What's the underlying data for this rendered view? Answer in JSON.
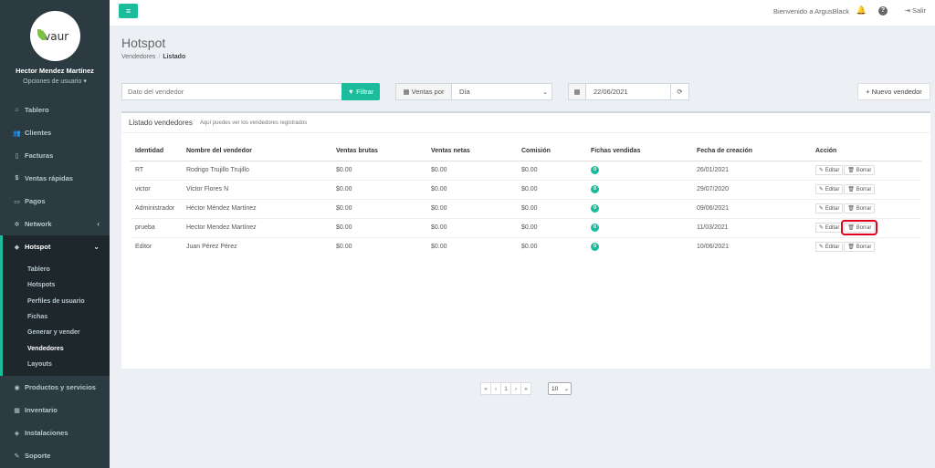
{
  "sidebar": {
    "logo_text": "ivaur",
    "user_name": "Hector Mendez Martínez",
    "user_options": "Opciones de usuario",
    "items": [
      {
        "label": "Tablero",
        "icon": "dashboard-icon",
        "glyph": "⌂"
      },
      {
        "label": "Clientes",
        "icon": "users-icon",
        "glyph": "👥"
      },
      {
        "label": "Facturas",
        "icon": "document-icon",
        "glyph": "▯"
      },
      {
        "label": "Ventas rápidas",
        "icon": "dollar-icon",
        "glyph": "$"
      },
      {
        "label": "Pagos",
        "icon": "money-icon",
        "glyph": "▭"
      },
      {
        "label": "Network",
        "icon": "network-icon",
        "glyph": "✲",
        "caret": "‹"
      },
      {
        "label": "Hotspot",
        "icon": "wifi-icon",
        "glyph": "◆",
        "caret": "⌄"
      }
    ],
    "hotspot_sub": [
      {
        "label": "Tablero"
      },
      {
        "label": "Hotspots"
      },
      {
        "label": "Perfiles de usuario"
      },
      {
        "label": "Fichas"
      },
      {
        "label": "Generar y vender"
      },
      {
        "label": "Vendedores"
      },
      {
        "label": "Layouts"
      }
    ],
    "bottom_items": [
      {
        "label": "Productos y servicios",
        "icon": "tags-icon",
        "glyph": "◉"
      },
      {
        "label": "Inventario",
        "icon": "cubes-icon",
        "glyph": "▦"
      },
      {
        "label": "Instalaciones",
        "icon": "tag-icon",
        "glyph": "◈"
      },
      {
        "label": "Soporte",
        "icon": "wrench-icon",
        "glyph": "✎"
      }
    ]
  },
  "topbar": {
    "menu_icon": "≡",
    "welcome": "Bienvenido a ArgusBlack",
    "logout": "Salir",
    "help": "?"
  },
  "header": {
    "title": "Hotspot",
    "breadcrumb_parent": "Vendedores",
    "breadcrumb_current": "Listado"
  },
  "filters": {
    "search_placeholder": "Dato del vendedor",
    "filter_label": "Filtrar",
    "ventas_por_label": "Ventas por",
    "period_value": "Día",
    "date_value": "22/06/2021",
    "new_label": "Nuevo vendedor"
  },
  "box": {
    "title": "Listado vendedores",
    "subtitle": "Aquí puedes ver los vendedores registrados"
  },
  "table": {
    "headers": [
      "Identidad",
      "Nombre del vendedor",
      "Ventas brutas",
      "Ventas netas",
      "Comisión",
      "Fichas vendidas",
      "Fecha de creación",
      "Acción"
    ],
    "rows": [
      {
        "id": "RT",
        "name": "Rodrigo Trujillo Trujillo",
        "gross": "$0.00",
        "net": "$0.00",
        "commission": "$0.00",
        "sold": "0",
        "created": "26/01/2021"
      },
      {
        "id": "victor",
        "name": "Victor Flores N",
        "gross": "$0.00",
        "net": "$0.00",
        "commission": "$0.00",
        "sold": "0",
        "created": "29/07/2020"
      },
      {
        "id": "Administrador",
        "name": "Héctor Méndez Martínez",
        "gross": "$0.00",
        "net": "$0.00",
        "commission": "$0.00",
        "sold": "0",
        "created": "09/06/2021"
      },
      {
        "id": "prueba",
        "name": "Hector Mendez Martínez",
        "gross": "$0.00",
        "net": "$0.00",
        "commission": "$0.00",
        "sold": "0",
        "created": "11/03/2021"
      },
      {
        "id": "Editor",
        "name": "Juan Pérez Pérez",
        "gross": "$0.00",
        "net": "$0.00",
        "commission": "$0.00",
        "sold": "0",
        "created": "10/06/2021"
      }
    ],
    "edit_label": "Editar",
    "delete_label": "Borrar"
  },
  "pagination": {
    "first": "«",
    "prev": "‹",
    "page": "1",
    "next": "›",
    "last": "»",
    "per_page": "10"
  },
  "colors": {
    "accent": "#1abc9c",
    "sidebar_bg": "#2c3b41",
    "highlight": "#e0001b"
  }
}
